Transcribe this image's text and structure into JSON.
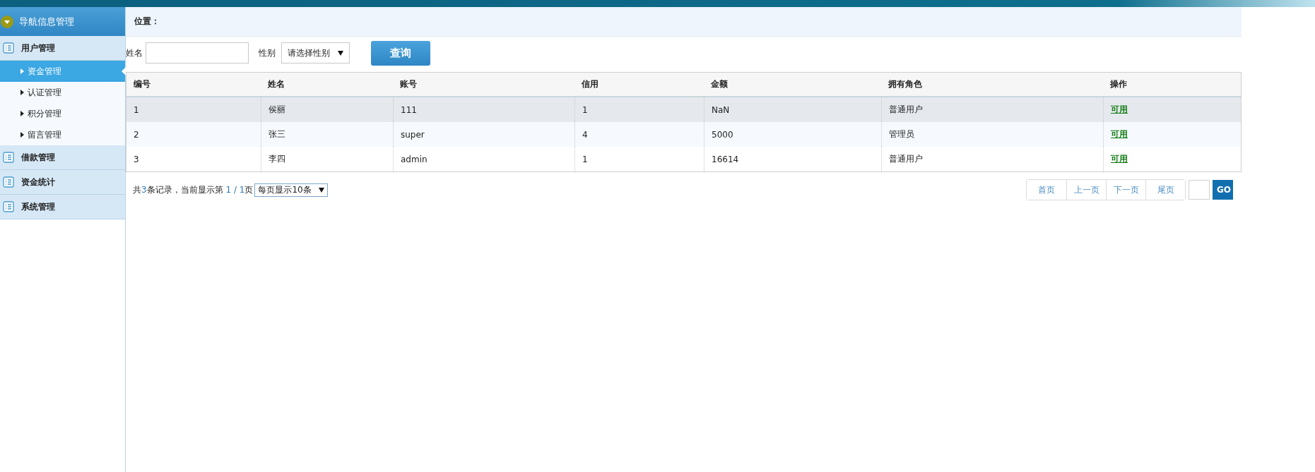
{
  "sidebar": {
    "title": "导航信息管理",
    "groups": [
      {
        "label": "用户管理",
        "items": [
          {
            "label": "资金管理",
            "selected": true
          },
          {
            "label": "认证管理",
            "selected": false
          },
          {
            "label": "积分管理",
            "selected": false
          },
          {
            "label": "留言管理",
            "selected": false
          }
        ]
      },
      {
        "label": "借款管理"
      },
      {
        "label": "资金统计"
      },
      {
        "label": "系统管理"
      }
    ]
  },
  "breadcrumb": {
    "label": "位置："
  },
  "search": {
    "name_label": "姓名",
    "gender_label": "性别",
    "gender_select": "请选择性别",
    "submit": "查询"
  },
  "table": {
    "columns": [
      "编号",
      "姓名",
      "账号",
      "信用",
      "金额",
      "拥有角色",
      "操作"
    ],
    "rows": [
      {
        "cells": [
          "1",
          "侯丽",
          "111",
          "1",
          "NaN",
          "普通用户"
        ],
        "action": "可用",
        "highlighted": true
      },
      {
        "cells": [
          "2",
          "张三",
          "super",
          "4",
          "5000",
          "管理员"
        ],
        "action": "可用",
        "highlighted": false
      },
      {
        "cells": [
          "3",
          "李四",
          "admin",
          "1",
          "16614",
          "普通用户"
        ],
        "action": "可用",
        "highlighted": false
      }
    ]
  },
  "pager": {
    "summary": [
      {
        "text": "共",
        "kind": "plain"
      },
      {
        "text": "3",
        "kind": "number"
      },
      {
        "text": "条记录，当前显示第 ",
        "kind": "plain"
      },
      {
        "text": "1 / 1",
        "kind": "number"
      },
      {
        "text": "页",
        "kind": "plain"
      }
    ],
    "page_size": "每页显示10条",
    "buttons": [
      "首页",
      "上一页",
      "下一页",
      "尾页"
    ],
    "go": "GO"
  }
}
